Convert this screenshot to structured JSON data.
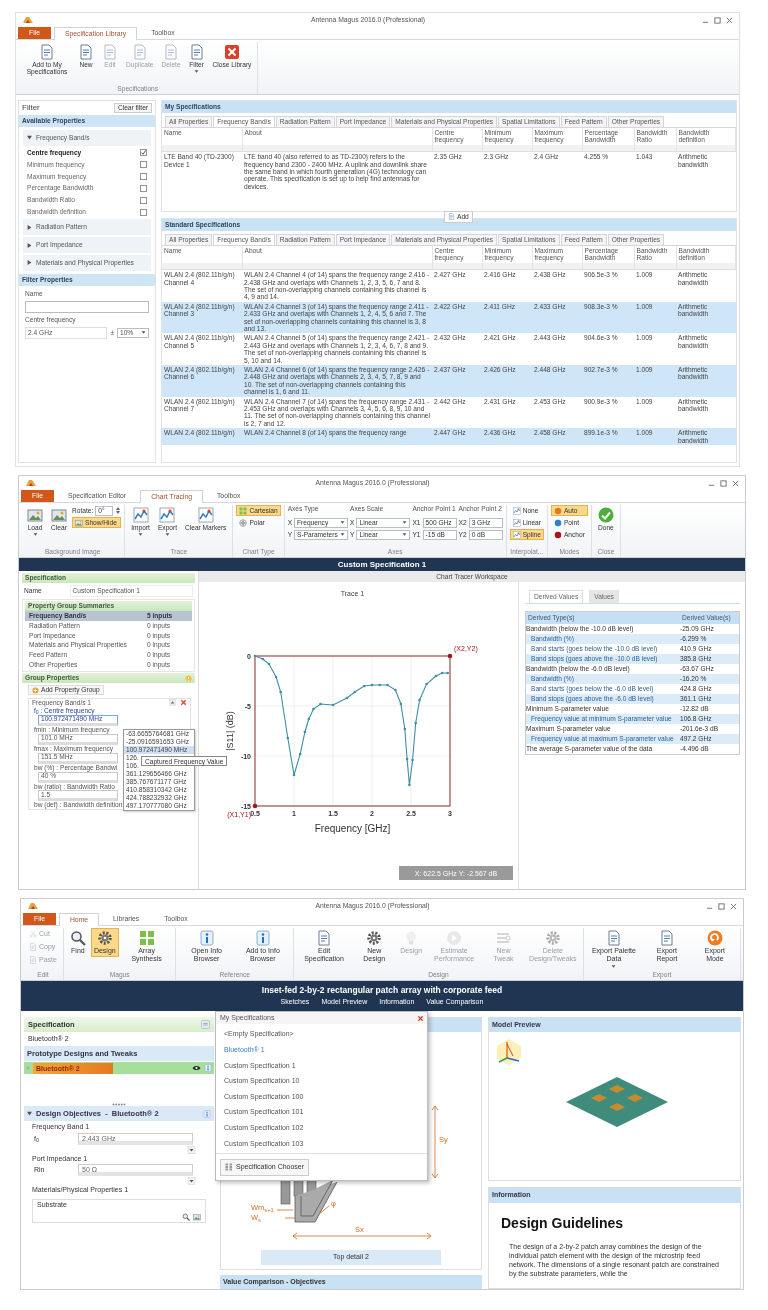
{
  "library_window": {
    "title": "Antenna Magus 2016.0 (Professional)",
    "tabs": [
      {
        "label": "File",
        "kind": "file",
        "selected": false
      },
      {
        "label": "Specification Library",
        "kind": "tab",
        "selected": true
      },
      {
        "label": "Toolbox",
        "kind": "tab",
        "selected": false
      }
    ],
    "ribbon": [
      {
        "label": "Specifications",
        "columns": [
          [
            {
              "kind": "big",
              "label": "Add to My Specifications",
              "disabled": false
            }
          ],
          [
            {
              "kind": "big",
              "label": "New",
              "disabled": false
            }
          ],
          [
            {
              "kind": "big",
              "label": "Edit",
              "disabled": true
            }
          ],
          [
            {
              "kind": "big",
              "label": "Duplicate",
              "disabled": true
            }
          ],
          [
            {
              "kind": "big",
              "label": "Delete",
              "disabled": true
            }
          ],
          [
            {
              "kind": "big",
              "label": "Filter",
              "disabled": false,
              "dropdown": true
            }
          ],
          [
            {
              "kind": "big",
              "label": "Close Library",
              "disabled": false
            }
          ]
        ]
      }
    ],
    "filter": {
      "title": "Filter",
      "clear_button": "Clear filter",
      "available_title": "Available Properties",
      "groups": [
        {
          "label": "Frequency Band/s",
          "expanded": true,
          "properties": [
            {
              "label": "Centre frequency",
              "checked": true
            },
            {
              "label": "Minimum frequency",
              "checked": false
            },
            {
              "label": "Maximum frequency",
              "checked": false
            },
            {
              "label": "Percentage Bandwidth",
              "checked": false
            },
            {
              "label": "Bandwidth Ratio",
              "checked": false
            },
            {
              "label": "Bandwidth definition",
              "checked": false
            }
          ]
        },
        {
          "label": "Radiation Pattern",
          "expanded": false
        },
        {
          "label": "Port Impedance",
          "expanded": false
        },
        {
          "label": "Materials and Physical Properties",
          "expanded": false
        }
      ],
      "properties_title": "Filter Properties",
      "name_label": "Name",
      "centre_label": "Centre frequency",
      "centre_value": "2.4 GHz",
      "plus_minus": "±",
      "tolerance": "10%"
    },
    "my_specifications": {
      "title": "My Specifications",
      "tabs": [
        {
          "label": "All Properties",
          "selected": false
        },
        {
          "label": "Frequency Band/s",
          "selected": true
        },
        {
          "label": "Radiation Pattern",
          "selected": false
        },
        {
          "label": "Port Impedance",
          "selected": false
        },
        {
          "label": "Materials and Physical Properties",
          "selected": false
        },
        {
          "label": "Spatial Limitations",
          "selected": false
        },
        {
          "label": "Feed Pattern",
          "selected": false
        },
        {
          "label": "Other Properties",
          "selected": false
        }
      ],
      "columns": [
        "Name",
        "About",
        "Centre frequency",
        "Minimum frequency",
        "Maximum frequency",
        "Percentage Bandwidth",
        "Bandwidth Ratio",
        "Bandwidth definition"
      ],
      "rows": [
        [
          "LTE Band 40 (TD-2300) Device 1",
          "LTE band 40 (also referred to as TD-2300) refers to the frequency band 2300 - 2400 MHz. A uplink and downlink share the same band in which fourth generation (4G) technology can operate. This specification is set up to help find antennas for devices.",
          "2.35 GHz",
          "2.3 GHz",
          "2.4 GHz",
          "4.255 %",
          "1.043",
          "Arithmetic bandwidth"
        ]
      ]
    },
    "standard_specifications": {
      "title": "Standard Specifications",
      "add_button": "Add",
      "tabs": [
        {
          "label": "All Properties",
          "selected": false
        },
        {
          "label": "Frequency Band/s",
          "selected": true
        },
        {
          "label": "Radiation Pattern",
          "selected": false
        },
        {
          "label": "Port Impedance",
          "selected": false
        },
        {
          "label": "Materials and Physical Properties",
          "selected": false
        },
        {
          "label": "Spatial Limitations",
          "selected": false
        },
        {
          "label": "Feed Pattern",
          "selected": false
        },
        {
          "label": "Other Properties",
          "selected": false
        }
      ],
      "columns": [
        "Name",
        "About",
        "Centre frequency",
        "Minimum frequency",
        "Maximum frequency",
        "Percentage Bandwidth",
        "Bandwidth Ratio",
        "Bandwidth definition"
      ],
      "rows": [
        [
          "WLAN 2.4 (802.11b/g/n) Channel 4",
          "WLAN 2.4 Channel 4 (of 14) spans the frequency range 2.416 - 2.438 GHz and overlaps with Channels 1, 2, 3, 5, 6, 7 and 8. The set of non-overlapping channels containing this channel is 4, 9 and 14.",
          "2.427 GHz",
          "2.416 GHz",
          "2.438 GHz",
          "906.5e-3 %",
          "1.009",
          "Arithmetic bandwidth"
        ],
        [
          "WLAN 2.4 (802.11b/g/n) Channel 3",
          "WLAN 2.4 Channel 3 (of 14) spans the frequency range 2.411 - 2.433 GHz and overlaps with Channels 1, 2, 4, 5, 6 and 7. The set of non-overlapping channels containing this channel is 3, 8 and 13.",
          "2.422 GHz",
          "2.411 GHz",
          "2.433 GHz",
          "908.3e-3 %",
          "1.009",
          "Arithmetic bandwidth"
        ],
        [
          "WLAN 2.4 (802.11b/g/n) Channel 5",
          "WLAN 2.4 Channel 5 (of 14) spans the frequency range 2.421 - 2.443 GHz and overlaps with Channels 1, 2, 3, 4, 6, 7, 8 and 9. The set of non-overlapping channels containing this channel is 5, 10 and 14.",
          "2.432 GHz",
          "2.421 GHz",
          "2.443 GHz",
          "904.6e-3 %",
          "1.009",
          "Arithmetic bandwidth"
        ],
        [
          "WLAN 2.4 (802.11b/g/n) Channel 6",
          "WLAN 2.4 Channel 6 (of 14) spans the frequency range 2.426 - 2.448 GHz and overlaps with Channels 2, 3, 4, 5, 7, 8, 9 and 10. The set of non-overlapping channels containing this channel is 1, 6 and 11.",
          "2.437 GHz",
          "2.426 GHz",
          "2.448 GHz",
          "902.7e-3 %",
          "1.009",
          "Arithmetic bandwidth"
        ],
        [
          "WLAN 2.4 (802.11b/g/n) Channel 7",
          "WLAN 2.4 Channel 7 (of 14) spans the frequency range 2.431 - 2.453 GHz and overlaps with Channels 3, 4, 5, 6, 8, 9, 10 and 11. The set of non-overlapping channels containing this channel is 2, 7 and 12.",
          "2.442 GHz",
          "2.431 GHz",
          "2.453 GHz",
          "900.9e-3 %",
          "1.009",
          "Arithmetic bandwidth"
        ],
        [
          "WLAN 2.4 (802.11b/g/n)",
          "WLAN 2.4 Channel 8 (of 14) spans the frequency range",
          "2.447 GHz",
          "2.436 GHz",
          "2.458 GHz",
          "899.1e-3 %",
          "1.009",
          "Arithmetic bandwidth"
        ]
      ]
    }
  },
  "tracer_window": {
    "title": "Antenna Magus 2016.0 (Professional)",
    "tabs": [
      {
        "label": "File",
        "kind": "file",
        "selected": false
      },
      {
        "label": "Specification Editor",
        "kind": "tab",
        "selected": false
      },
      {
        "label": "Chart Tracing",
        "kind": "tab",
        "selected": true
      },
      {
        "label": "Toolbox",
        "kind": "tab",
        "selected": false
      }
    ],
    "ribbon": [
      {
        "label": "Background Image",
        "columns": [
          [
            {
              "kind": "big",
              "label": "Load",
              "dropdown": true
            }
          ],
          [
            {
              "kind": "big",
              "label": "Clear"
            }
          ],
          [
            {
              "kind": "spin",
              "label": "Rotate:",
              "value": "0°"
            },
            {
              "kind": "small",
              "label": "Show/Hide",
              "selected": true
            }
          ]
        ]
      },
      {
        "label": "Trace",
        "columns": [
          [
            {
              "kind": "big",
              "label": "Import",
              "dropdown": true
            }
          ],
          [
            {
              "kind": "big",
              "label": "Export",
              "dropdown": true
            }
          ],
          [
            {
              "kind": "big",
              "label": "Clear Markers"
            }
          ]
        ]
      },
      {
        "label": "Chart Type",
        "columns": [
          [
            {
              "kind": "small",
              "label": "Cartesian",
              "selected": true
            },
            {
              "kind": "small",
              "label": "Polar",
              "selected": false
            }
          ]
        ]
      },
      {
        "label": "Axes",
        "columns": [
          [
            {
              "kind": "caption",
              "label": "Axes Type"
            },
            {
              "kind": "select",
              "prefix": "X",
              "value": "Frequency"
            },
            {
              "kind": "select",
              "prefix": "Y",
              "value": "S-Parameters"
            }
          ],
          [
            {
              "kind": "caption",
              "label": "Axes Scale"
            },
            {
              "kind": "select",
              "prefix": "X",
              "value": "Linear"
            },
            {
              "kind": "select",
              "prefix": "Y",
              "value": "Linear"
            }
          ],
          [
            {
              "kind": "caption",
              "label": "Anchor Point 1"
            },
            {
              "kind": "field",
              "prefix": "X1",
              "value": "500 GHz"
            },
            {
              "kind": "field",
              "prefix": "Y1",
              "value": "-15 dB"
            }
          ],
          [
            {
              "kind": "caption",
              "label": "Anchor Point 2"
            },
            {
              "kind": "field",
              "prefix": "X2",
              "value": "3 GHz"
            },
            {
              "kind": "field",
              "prefix": "Y2",
              "value": "0 dB"
            }
          ]
        ]
      },
      {
        "label": "Interpolat...",
        "columns": [
          [
            {
              "kind": "small",
              "label": "None",
              "selected": false
            },
            {
              "kind": "small",
              "label": "Linear",
              "selected": false
            },
            {
              "kind": "small",
              "label": "Spline",
              "selected": true
            }
          ]
        ]
      },
      {
        "label": "Modes",
        "columns": [
          [
            {
              "kind": "small",
              "label": "Auto",
              "selected": true
            },
            {
              "kind": "small",
              "label": "Point",
              "selected": false
            },
            {
              "kind": "small",
              "label": "Anchor",
              "selected": false
            }
          ]
        ]
      },
      {
        "label": "Close",
        "columns": [
          [
            {
              "kind": "big",
              "label": "Done"
            }
          ]
        ]
      }
    ],
    "document_title": "Custom Specification 1",
    "specification": {
      "title": "Specification",
      "name_label": "Name",
      "name_value": "Custom Specification 1"
    },
    "summaries": {
      "title": "Property Group Summaries",
      "rows": [
        {
          "label": "Frequency Band/s",
          "value": "5 inputs",
          "selected": true
        },
        {
          "label": "Radiation Pattern",
          "value": "0 inputs",
          "selected": false
        },
        {
          "label": "Port Impedance",
          "value": "0 inputs",
          "selected": false
        },
        {
          "label": "Materials and Physical Properties",
          "value": "0 inputs",
          "selected": false
        },
        {
          "label": "Feed Pattern",
          "value": "0 inputs",
          "selected": false
        },
        {
          "label": "Other Properties",
          "value": "0 inputs",
          "selected": false
        }
      ]
    },
    "group_properties": {
      "title": "Group Properties",
      "add_button": "Add Property Group",
      "group_title": "Frequency Band/s 1",
      "fields": [
        {
          "label": "f$_{0}$ : Centre frequency",
          "value": "100.972471490 MHz",
          "kind": "active"
        },
        {
          "label": "fmin : Minimum frequency",
          "value": "101.0 MHz",
          "kind": "plain"
        },
        {
          "label": "fmax : Maximum frequency",
          "value": "151.5 MHz",
          "kind": "plain"
        },
        {
          "label": "bw (%) : Percentage Bandwi",
          "value": "40 %",
          "kind": "plain"
        },
        {
          "label": "bw (ratio) : Bandwidth Ratio",
          "value": "1.5",
          "kind": "plain"
        },
        {
          "label": "bw (def) : Bandwidth definition",
          "kind": "plain"
        }
      ],
      "dropdown": {
        "items": [
          {
            "label": "-63.6655764681 GHz",
            "selected": false
          },
          {
            "label": "-25.0916591653 GHz",
            "selected": false
          },
          {
            "label": "100.972471490 MHz",
            "selected": true
          },
          {
            "label": "126.",
            "selected": false
          },
          {
            "label": "106.",
            "selected": false
          },
          {
            "label": "361.129656466 GHz",
            "selected": false
          },
          {
            "label": "385.767671177 GHz",
            "selected": false
          },
          {
            "label": "410.858310342 GHz",
            "selected": false
          },
          {
            "label": "424.788232932 GHz",
            "selected": false
          },
          {
            "label": "497.170777080 GHz",
            "selected": false
          }
        ],
        "tooltip": "Captured Frequency Value"
      }
    },
    "workspace": {
      "title": "Chart Tracer Workspace",
      "readout": "X: 622.5 GHz  Y: -2.567 dB",
      "chart_data": {
        "type": "line",
        "xlabel": "Frequency [GHz]",
        "ylabel": "|S11| (dB)",
        "grid": true,
        "x": [
          0.5,
          0.6,
          0.68,
          0.77,
          0.83,
          0.92,
          1.0,
          1.08,
          1.14,
          1.19,
          1.25,
          1.34,
          1.5,
          1.68,
          1.78,
          1.9,
          2.0,
          2.1,
          2.2,
          2.3,
          2.37,
          2.42,
          2.45,
          2.48,
          2.52,
          2.56,
          2.61,
          2.7,
          2.82,
          2.9,
          2.97
        ],
        "series": [
          {
            "name": "Trace 1",
            "color": "#3d8ea6",
            "values": [
              0,
              -0.3,
              -0.8,
              -2.1,
              -3.6,
              -8.2,
              -11.9,
              -9.8,
              -7.6,
              -6.3,
              -5.3,
              -4.8,
              -4.9,
              -4.2,
              -3.6,
              -3.0,
              -2.9,
              -2.9,
              -2.9,
              -3.4,
              -4.8,
              -7.3,
              -10.3,
              -12.9,
              -10.4,
              -6.7,
              -4.4,
              -2.8,
              -2.0,
              -1.7,
              -1.7
            ]
          }
        ],
        "xlim": [
          0.5,
          3
        ],
        "ylim": [
          -15,
          0
        ],
        "xticks": [
          0.5,
          1,
          1.5,
          2,
          2.5,
          3
        ],
        "yticks": [
          0,
          -5,
          -10,
          -15
        ],
        "annotations": [
          "(X1,Y1)",
          "(X2,Y2)"
        ]
      }
    },
    "derived": {
      "tabs": [
        {
          "label": "Derived Values",
          "selected": true
        },
        {
          "label": "Values",
          "selected": false
        }
      ],
      "columns": [
        "Derived Type(s)",
        "Derived Value(s)"
      ],
      "rows": [
        {
          "label": "Bandwidth (below the -10.0 dB level)",
          "value": "-25.09 GHz",
          "children": [
            {
              "label": "Bandwidth (%)",
              "value": "-6.299 %"
            },
            {
              "label": "Band starts (goes below the -10.0 dB level)",
              "value": "410.9 GHz"
            },
            {
              "label": "Band stops (goes above the -10.0 dB level)",
              "value": "385.8 GHz"
            }
          ]
        },
        {
          "label": "Bandwidth (below the -6.0 dB level)",
          "value": "-63.67 GHz",
          "children": [
            {
              "label": "Bandwidth (%)",
              "value": "-16.20 %"
            },
            {
              "label": "Band starts (goes below the -6.0 dB level)",
              "value": "424.8 GHz"
            },
            {
              "label": "Band stops (goes above the -6.0 dB level)",
              "value": "361.1 GHz"
            }
          ]
        },
        {
          "label": "Minimum S-parameter value",
          "value": "-12.82 dB",
          "children": [
            {
              "label": "Frequency value at minimum S-parameter value",
              "value": "106.8 GHz"
            }
          ]
        },
        {
          "label": "Maximum S-parameter value",
          "value": "-201.6e-3 dB",
          "children": [
            {
              "label": "Frequency value at maximum S-parameter value",
              "value": "497.2 GHz"
            }
          ]
        },
        {
          "label": "The average S-parameter value of the data",
          "value": "-4.496 dB"
        }
      ]
    }
  },
  "design_window": {
    "title": "Antenna Magus 2016.0 (Professional)",
    "tabs": [
      {
        "label": "File",
        "kind": "file",
        "selected": false
      },
      {
        "label": "Home",
        "kind": "tab",
        "selected": true
      },
      {
        "label": "Libraries",
        "kind": "tab",
        "selected": false
      },
      {
        "label": "Toolbox",
        "kind": "tab",
        "selected": false
      }
    ],
    "ribbon": [
      {
        "label": "Edit",
        "columns": [
          [
            {
              "kind": "small",
              "label": "Cut",
              "disabled": true
            },
            {
              "kind": "small",
              "label": "Copy",
              "disabled": true
            },
            {
              "kind": "small",
              "label": "Paste",
              "disabled": true
            }
          ]
        ]
      },
      {
        "label": "Magus",
        "columns": [
          [
            {
              "kind": "big",
              "label": "Find",
              "selected": false,
              "disabled": false
            }
          ],
          [
            {
              "kind": "big",
              "label": "Design",
              "selected": true,
              "disabled": false
            }
          ],
          [
            {
              "kind": "big",
              "label": "Array Synthesis",
              "selected": false,
              "disabled": false
            }
          ]
        ]
      },
      {
        "label": "Reference",
        "columns": [
          [
            {
              "kind": "big",
              "label": "Open Info Browser",
              "disabled": false
            }
          ],
          [
            {
              "kind": "big",
              "label": "Add to Info Browser",
              "disabled": false
            }
          ]
        ]
      },
      {
        "label": "Design",
        "columns": [
          [
            {
              "kind": "big",
              "label": "Edit Specification",
              "disabled": false
            }
          ],
          [
            {
              "kind": "big",
              "label": "New Design",
              "disabled": false
            }
          ],
          [
            {
              "kind": "big",
              "label": "Design",
              "disabled": true
            }
          ],
          [
            {
              "kind": "big",
              "label": "Estimate Performance",
              "disabled": true
            }
          ],
          [
            {
              "kind": "big",
              "label": "New Tweak",
              "disabled": true
            }
          ],
          [
            {
              "kind": "big",
              "label": "Delete Design/Tweaks",
              "disabled": true
            }
          ]
        ]
      },
      {
        "label": "Export",
        "columns": [
          [
            {
              "kind": "big",
              "label": "Export Palette Data",
              "disabled": false,
              "dropdown": true
            }
          ],
          [
            {
              "kind": "big",
              "label": "Export Report",
              "disabled": false
            }
          ],
          [
            {
              "kind": "big",
              "label": "Export Mode",
              "disabled": false
            }
          ]
        ]
      }
    ],
    "document_title": "Inset-fed 2-by-2 rectangular patch array with corporate feed",
    "views": [
      "Sketches",
      "Model Preview",
      "Information",
      "Value Comparison"
    ],
    "specification": {
      "title": "Specification",
      "value": "Bluetooth® 2"
    },
    "prototypes": {
      "title": "Prototype Designs and Tweaks",
      "items": [
        {
          "label": "Bluetooth® 2",
          "selected": true
        }
      ]
    },
    "objectives": {
      "title": "Design Objectives  -  Bluetooth® 2",
      "expanded": true,
      "groups": [
        {
          "title": "Frequency Band 1",
          "symbol": "f$_{0}$",
          "value": "2.443 GHz"
        },
        {
          "title": "Port Impedance 1",
          "symbol": "Rin",
          "value": "50 Ω"
        }
      ],
      "materials_title": "Materials/Physical Properties 1",
      "substrate_label": "Substrate"
    },
    "spec_menu": {
      "title": "My Specifications",
      "items": [
        {
          "label": "<Empty Specification>",
          "selected": false
        },
        {
          "label": "Bluetooth® 1",
          "selected": true
        },
        {
          "label": "Custom Specification 1",
          "selected": false
        },
        {
          "label": "Custom Specification 10",
          "selected": false
        },
        {
          "label": "Custom Specification 100",
          "selected": false
        },
        {
          "label": "Custom Specification 101",
          "selected": false
        },
        {
          "label": "Custom Specification 102",
          "selected": false
        },
        {
          "label": "Custom Specification 103",
          "selected": false
        }
      ],
      "chooser_button": "Specification Chooser"
    },
    "sketch": {
      "labels": [
        "Sy",
        "Wm$_{s+1}$",
        "W$_{s}$",
        "φ",
        "Sx"
      ],
      "caption": "Top detail 2",
      "comparison_title": "Value Comparison - Objectives"
    },
    "model_preview": {
      "title": "Model Preview"
    },
    "information": {
      "title": "Information",
      "heading": "Design Guidelines",
      "text": "The design of a 2-by-2 patch array combines the design of the individual patch element with the design of the microstrip feed network. The dimensions of a single resonant patch are constrained by the substrate parameters, while the"
    }
  }
}
